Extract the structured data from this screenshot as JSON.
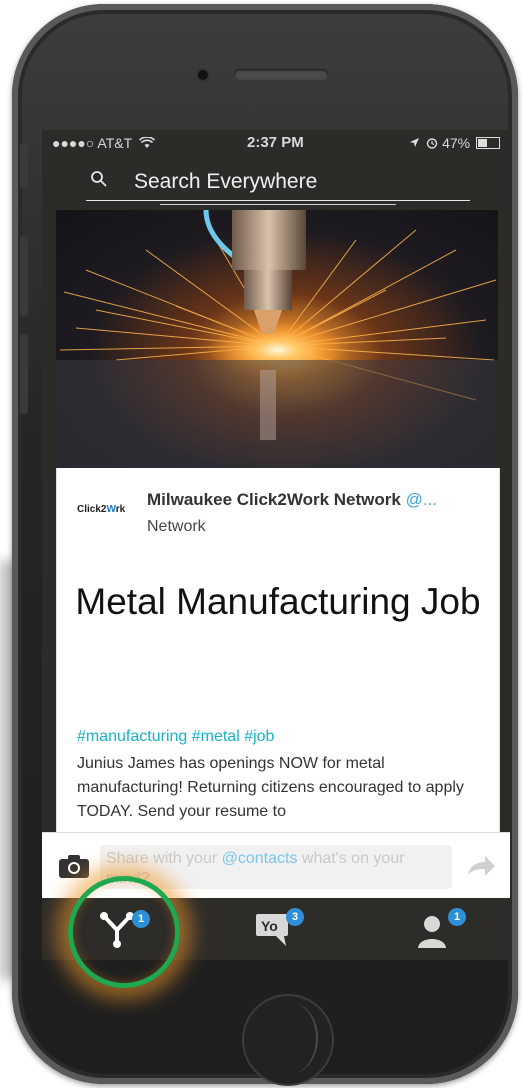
{
  "status_bar": {
    "carrier": "●●●●○ AT&T",
    "time": "2:37 PM",
    "battery": "47%",
    "battery_level": 0.47
  },
  "search": {
    "placeholder": "Search Everywhere"
  },
  "post": {
    "org_logo_text_1": "Click2",
    "org_logo_text_2": "W",
    "org_logo_text_3": "rk",
    "org_name": "Milwaukee Click2Work Network",
    "org_handle": " @...",
    "org_type": "Network",
    "title": "Metal Manufacturing Job",
    "tags": "#manufacturing #metal #job",
    "body": "Junius James has openings NOW for metal manufacturing! Returning citizens encouraged to apply TODAY. Send your resume to"
  },
  "composer": {
    "text_before": "Share with your ",
    "mention": "@contacts",
    "text_after": " what's on your mind?"
  },
  "tabbar": {
    "tabs": [
      {
        "name": "home",
        "badge": "1"
      },
      {
        "name": "messages",
        "icon_label": "Yo",
        "badge": "3"
      },
      {
        "name": "profile",
        "badge": "1"
      }
    ]
  },
  "colors": {
    "accent": "#1ab2c7",
    "badge": "#2f8fd6",
    "highlight_ring": "#1fa84f",
    "highlight_glow": "#ec9628"
  }
}
